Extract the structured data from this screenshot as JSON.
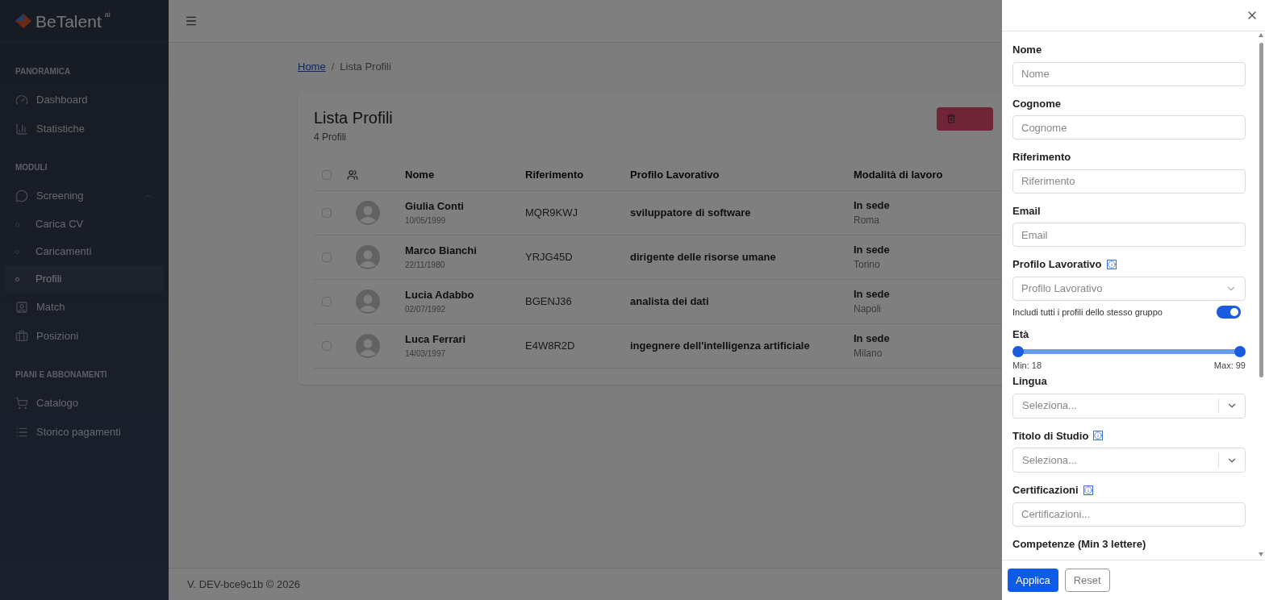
{
  "sidebar": {
    "logo": {
      "name": "BeTalent",
      "superscript": "ai"
    },
    "sections": [
      {
        "title": "PANORAMICA",
        "items": [
          {
            "label": "Dashboard"
          },
          {
            "label": "Statistiche"
          }
        ]
      },
      {
        "title": "MODULI",
        "items": [
          {
            "label": "Screening",
            "expanded": true,
            "children": [
              {
                "label": "Carica CV",
                "selected": false
              },
              {
                "label": "Caricamenti",
                "selected": false
              },
              {
                "label": "Profili",
                "selected": true
              }
            ]
          },
          {
            "label": "Match"
          },
          {
            "label": "Posizioni"
          }
        ]
      },
      {
        "title": "PIANI E ABBONAMENTI",
        "items": [
          {
            "label": "Catalogo"
          },
          {
            "label": "Storico pagamenti"
          }
        ]
      }
    ]
  },
  "breadcrumb": {
    "items": [
      {
        "label": "Home",
        "kind": "link"
      },
      {
        "label": "Lista Profili",
        "kind": "current"
      }
    ],
    "separator": "/"
  },
  "card": {
    "title": "Lista Profili",
    "subtitle": "4 Profili",
    "table": {
      "select_all_checked": false,
      "columns": [
        "Nome",
        "Riferimento",
        "Profilo Lavorativo",
        "Modalità di lavoro"
      ],
      "rows": [
        {
          "checked": false,
          "name": "Giulia Conti",
          "birth": "10/05/1999",
          "reference": "MQR9KWJ",
          "profile": "sviluppatore di software",
          "mode": "In sede",
          "city": "Roma"
        },
        {
          "checked": false,
          "name": "Marco Bianchi",
          "birth": "22/11/1980",
          "reference": "YRJG45D",
          "profile": "dirigente delle risorse umane",
          "mode": "In sede",
          "city": "Torino"
        },
        {
          "checked": false,
          "name": "Lucia Adabbo",
          "birth": "02/07/1992",
          "reference": "BGENJ36",
          "profile": "analista dei dati",
          "mode": "In sede",
          "city": "Napoli"
        },
        {
          "checked": false,
          "name": "Luca Ferrari",
          "birth": "14/03/1997",
          "reference": "E4W8R2D",
          "profile": "ingegnere dell'intelligenza artificiale",
          "mode": "In sede",
          "city": "Milano"
        }
      ]
    }
  },
  "footer": "V. DEV-bce9c1b © 2026",
  "drawer": {
    "fields": [
      {
        "kind": "text",
        "label": "Nome",
        "placeholder": "Nome",
        "info": false
      },
      {
        "kind": "text",
        "label": "Cognome",
        "placeholder": "Cognome",
        "info": false
      },
      {
        "kind": "text",
        "label": "Riferimento",
        "placeholder": "Riferimento",
        "info": false
      },
      {
        "kind": "text",
        "label": "Email",
        "placeholder": "Email",
        "info": false
      },
      {
        "kind": "select",
        "label": "Profilo Lavorativo",
        "placeholder": "Profilo Lavorativo",
        "info": true,
        "toggle": {
          "label": "Includi tutti i profili dello stesso gruppo",
          "on": true
        }
      },
      {
        "kind": "range",
        "label": "Età",
        "min_label": "Min: 18",
        "max_label": "Max: 99",
        "thumbs": [
          {
            "level": 0
          },
          {
            "level": 1
          }
        ]
      },
      {
        "kind": "combo",
        "label": "Lingua",
        "placeholder": "Seleziona...",
        "info": false
      },
      {
        "kind": "combo",
        "label": "Titolo di Studio",
        "placeholder": "Seleziona...",
        "info": true
      },
      {
        "kind": "text",
        "label": "Certificazioni",
        "placeholder": "Certificazioni...",
        "info": true
      },
      {
        "kind": "heading",
        "label": "Competenze (Min 3 lettere)"
      }
    ],
    "buttons": [
      {
        "label": "Applica",
        "kind": "primary"
      },
      {
        "label": "Reset",
        "kind": "secondary"
      }
    ]
  }
}
